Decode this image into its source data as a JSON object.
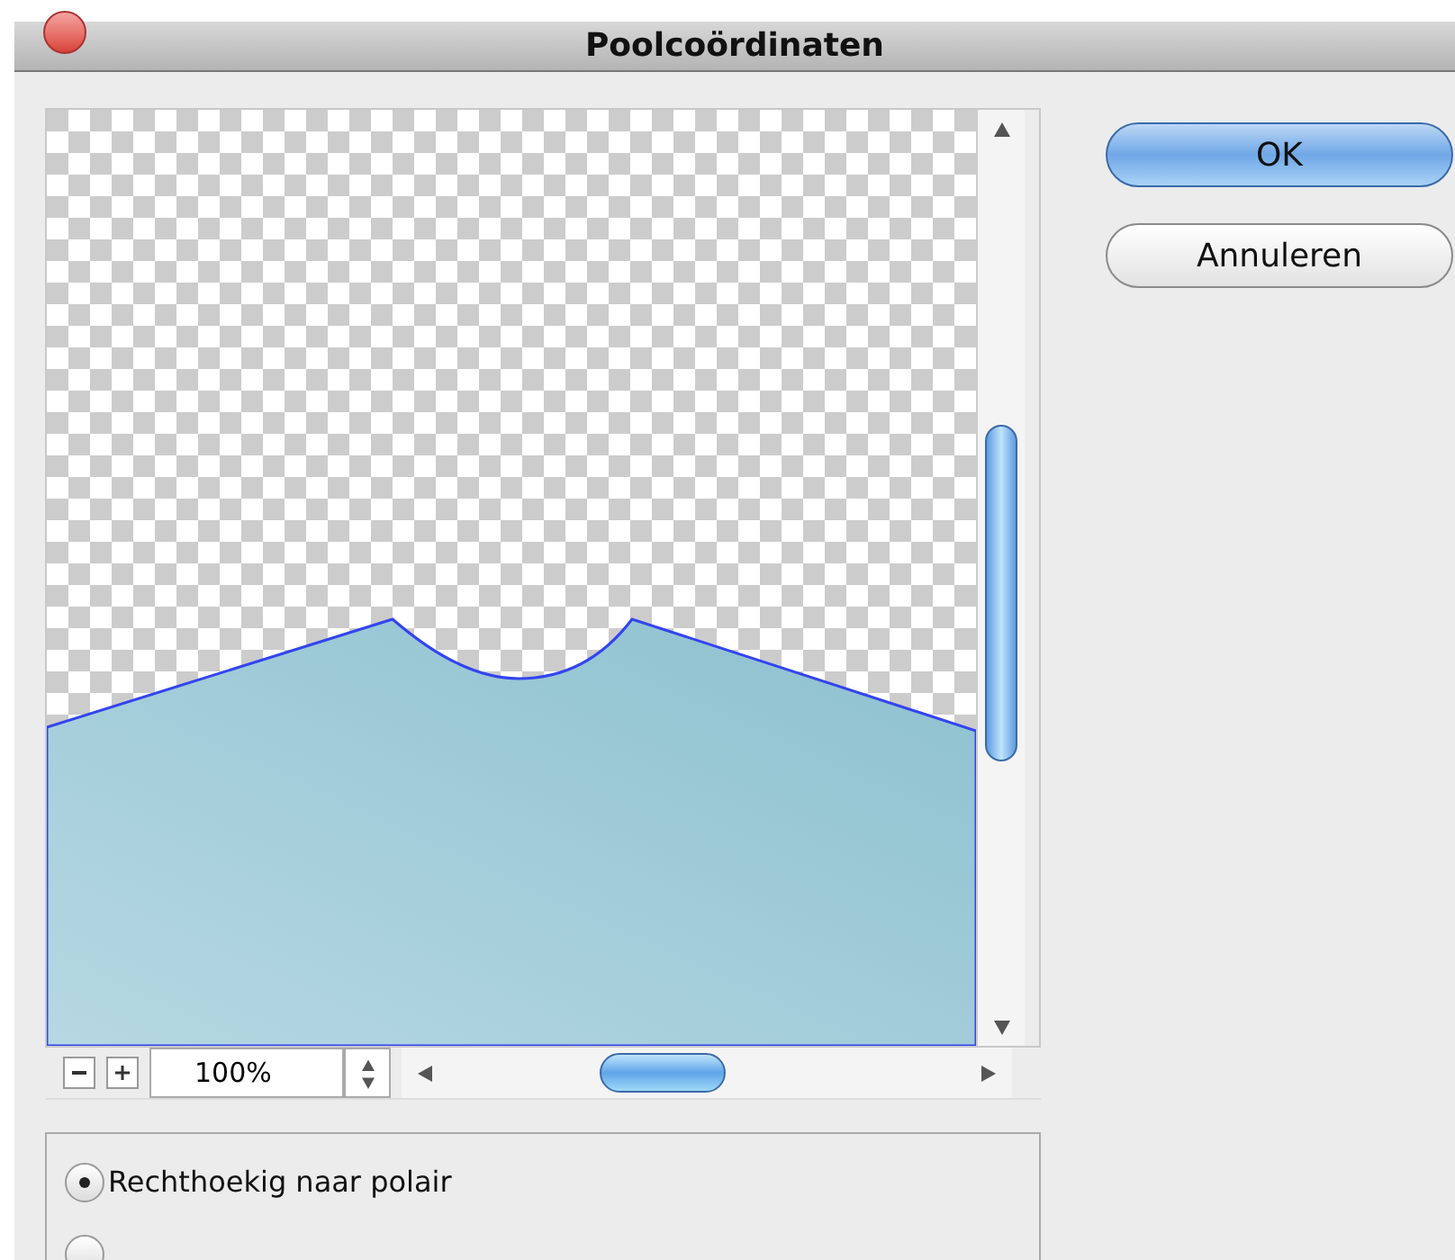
{
  "window": {
    "title": "Poolcoördinaten"
  },
  "preview": {
    "zoom": "100%"
  },
  "buttons": [
    {
      "label": "OK",
      "default": true
    },
    {
      "label": "Annuleren",
      "default": false
    }
  ],
  "options": [
    {
      "label": "Rechthoekig naar polair",
      "selected": true
    },
    {
      "selected": false
    }
  ]
}
